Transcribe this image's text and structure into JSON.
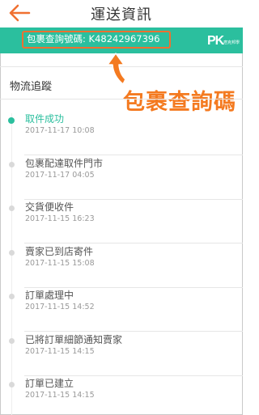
{
  "header": {
    "title": "運送資訊",
    "back_icon": "back-arrow-icon",
    "accent_color": "#2bbf9e",
    "back_color": "#f07030"
  },
  "tracking": {
    "label": "包裹查詢號碼: K48242967396",
    "logo_text": "PK",
    "logo_subtext": "痞克邦學"
  },
  "annotation": {
    "label": "包裹查詢碼",
    "color": "#f47a20"
  },
  "section": {
    "title": "物流追蹤"
  },
  "timeline": [
    {
      "status": "取件成功",
      "time": "2017-11-17 10:08",
      "active": true
    },
    {
      "status": "包裹配達取件門市",
      "time": "2017-11-17 04:05",
      "active": false
    },
    {
      "status": "交貨便收件",
      "time": "2017-11-15 16:23",
      "active": false
    },
    {
      "status": "賣家已到店寄件",
      "time": "2017-11-15 15:08",
      "active": false
    },
    {
      "status": "訂單處理中",
      "time": "2017-11-15 14:52",
      "active": false
    },
    {
      "status": "已將訂單細節通知賣家",
      "time": "2017-11-15 14:15",
      "active": false
    },
    {
      "status": "訂單已建立",
      "time": "2017-11-15 14:15",
      "active": false
    }
  ]
}
